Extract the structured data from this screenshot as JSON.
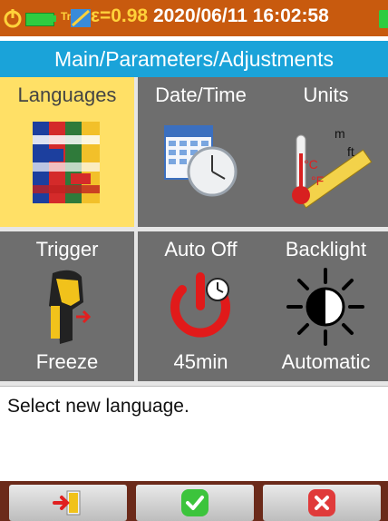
{
  "status_bar": {
    "laser_indicator": "Tr",
    "emissivity": "ε=0.98",
    "datetime": "2020/06/11 16:02:58",
    "icons": [
      "power-icon",
      "battery-icon",
      "laser-icon",
      "emissivity-icon",
      "storage-icon"
    ]
  },
  "breadcrumb": "Main/Parameters/Adjustments",
  "tiles": [
    {
      "id": "languages",
      "label": "Languages",
      "icon": "flags-icon",
      "selected": true
    },
    {
      "id": "datetime",
      "label": "Date/Time",
      "icon": "calendar-clock-icon"
    },
    {
      "id": "units",
      "label": "Units",
      "icon": "thermometer-ruler-icon",
      "icon_text": [
        "m",
        "ft",
        "°C",
        "°F"
      ]
    },
    {
      "id": "trigger",
      "label": "Trigger",
      "value": "Freeze",
      "icon": "camera-trigger-icon"
    },
    {
      "id": "autooff",
      "label": "Auto Off",
      "value": "45min",
      "icon": "power-timer-icon"
    },
    {
      "id": "backlight",
      "label": "Backlight",
      "value": "Automatic",
      "icon": "brightness-icon"
    }
  ],
  "message": "Select new language.",
  "buttons": [
    {
      "id": "exit",
      "icon": "exit-door-icon"
    },
    {
      "id": "confirm",
      "icon": "checkmark-icon",
      "color": "#3cc43c"
    },
    {
      "id": "cancel",
      "icon": "cancel-x-icon",
      "color": "#e03a3a"
    }
  ]
}
